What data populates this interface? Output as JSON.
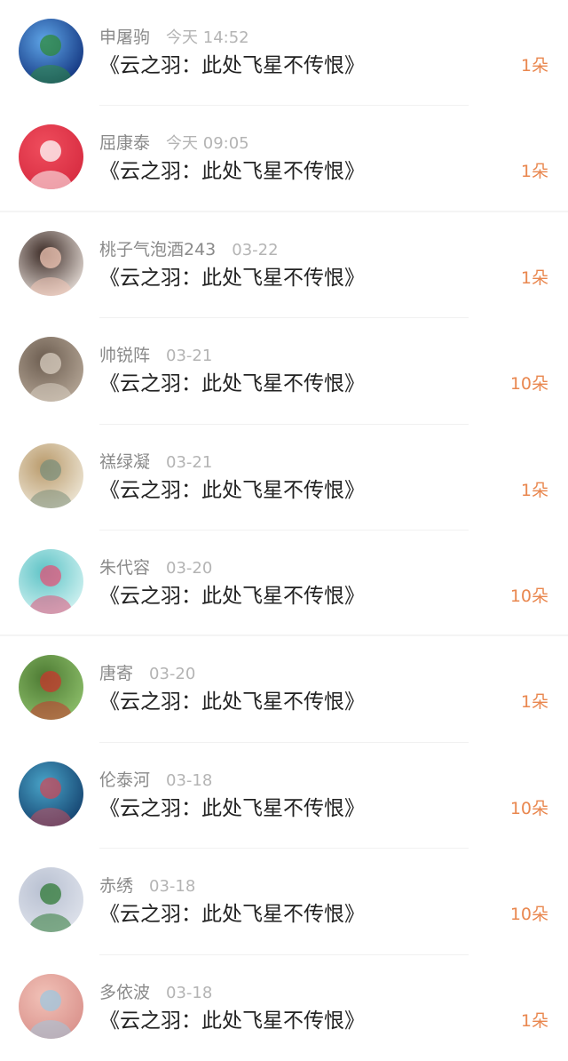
{
  "rows": [
    {
      "name": "申屠驹",
      "time": "今天 14:52",
      "title": "《云之羽：此处飞星不传恨》",
      "count": "1朵",
      "avatar": {
        "label": "night-sky-avatar",
        "c1": "#0f2f7a",
        "c2": "#5fa6e8",
        "c3": "#2f8a3a"
      }
    },
    {
      "name": "屈康泰",
      "time": "今天 09:05",
      "title": "《云之羽：此处飞星不传恨》",
      "count": "1朵",
      "avatar": {
        "label": "red-ball-avatar",
        "c1": "#d62a3f",
        "c2": "#ef4d5d",
        "c3": "#ffffff"
      }
    },
    {
      "name": "桃子气泡酒243",
      "time": "03-22",
      "title": "《云之羽：此处飞星不传恨》",
      "count": "1朵",
      "avatar": {
        "label": "girl-portrait-avatar",
        "c1": "#e8dfd9",
        "c2": "#3b2a25",
        "c3": "#f2c7b6"
      }
    },
    {
      "name": "帅锐阵",
      "time": "03-21",
      "title": "《云之羽：此处飞星不传恨》",
      "count": "10朵",
      "avatar": {
        "label": "guitar-room-avatar",
        "c1": "#b6a797",
        "c2": "#6c5d50",
        "c3": "#d9cfc2"
      }
    },
    {
      "name": "禚绿凝",
      "time": "03-21",
      "title": "《云之羽：此处飞星不传恨》",
      "count": "1朵",
      "avatar": {
        "label": "sketch-girl-avatar",
        "c1": "#efe8d8",
        "c2": "#b99a6b",
        "c3": "#7b8f7b"
      }
    },
    {
      "name": "朱代容",
      "time": "03-20",
      "title": "《云之羽：此处飞星不传恨》",
      "count": "10朵",
      "avatar": {
        "label": "aries-cartoon-avatar",
        "c1": "#d4f3f2",
        "c2": "#5ec3c6",
        "c3": "#e2547a"
      }
    },
    {
      "name": "唐寄",
      "time": "03-20",
      "title": "《云之羽：此处飞星不传恨》",
      "count": "1朵",
      "avatar": {
        "label": "boy-outdoor-avatar",
        "c1": "#8ec06b",
        "c2": "#4d7a33",
        "c3": "#c8372d"
      }
    },
    {
      "name": "伦泰河",
      "time": "03-18",
      "title": "《云之羽：此处飞星不传恨》",
      "count": "10朵",
      "avatar": {
        "label": "anime-art-avatar",
        "c1": "#123e6b",
        "c2": "#49a4c8",
        "c3": "#c94a5a"
      }
    },
    {
      "name": "赤绣",
      "time": "03-18",
      "title": "《云之羽：此处飞星不传恨》",
      "count": "10朵",
      "avatar": {
        "label": "leaf-hand-avatar",
        "c1": "#dfe3ec",
        "c2": "#b8c0d1",
        "c3": "#2f7a36"
      }
    },
    {
      "name": "多依波",
      "time": "03-18",
      "title": "《云之羽：此处飞星不传恨》",
      "count": "1朵",
      "avatar": {
        "label": "masked-face-avatar",
        "c1": "#d9908a",
        "c2": "#f1c1b7",
        "c3": "#9ec7df"
      }
    }
  ]
}
